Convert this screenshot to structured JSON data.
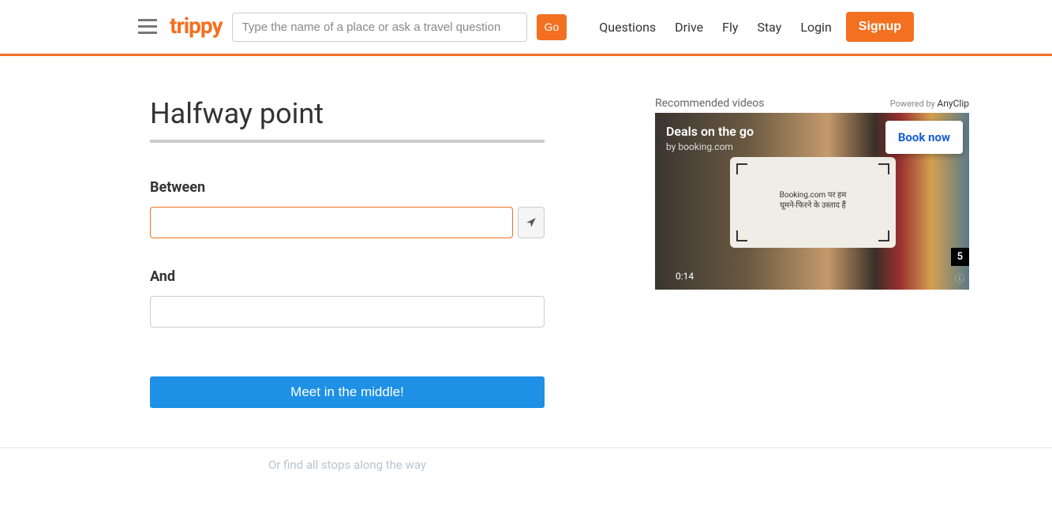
{
  "header": {
    "logo": "trippy",
    "search_placeholder": "Type the name of a place or ask a travel question",
    "go_label": "Go",
    "nav": {
      "questions": "Questions",
      "drive": "Drive",
      "fly": "Fly",
      "stay": "Stay",
      "login": "Login",
      "signup": "Signup"
    }
  },
  "main": {
    "title": "Halfway point",
    "between_label": "Between",
    "and_label": "And",
    "submit_label": "Meet in the middle!",
    "find_stops": "Or find all stops along the way"
  },
  "video": {
    "recommended": "Recommended videos",
    "powered": "Powered by ",
    "powered_brand": "AnyClip",
    "title": "Deals on the go",
    "subtitle": "by booking.com",
    "card_line1": "Booking.com पर हम",
    "card_line2": "घूमने-फिरने के उस्ताद हैं",
    "book_now": "Book now",
    "time": "0:14",
    "countdown": "5"
  }
}
